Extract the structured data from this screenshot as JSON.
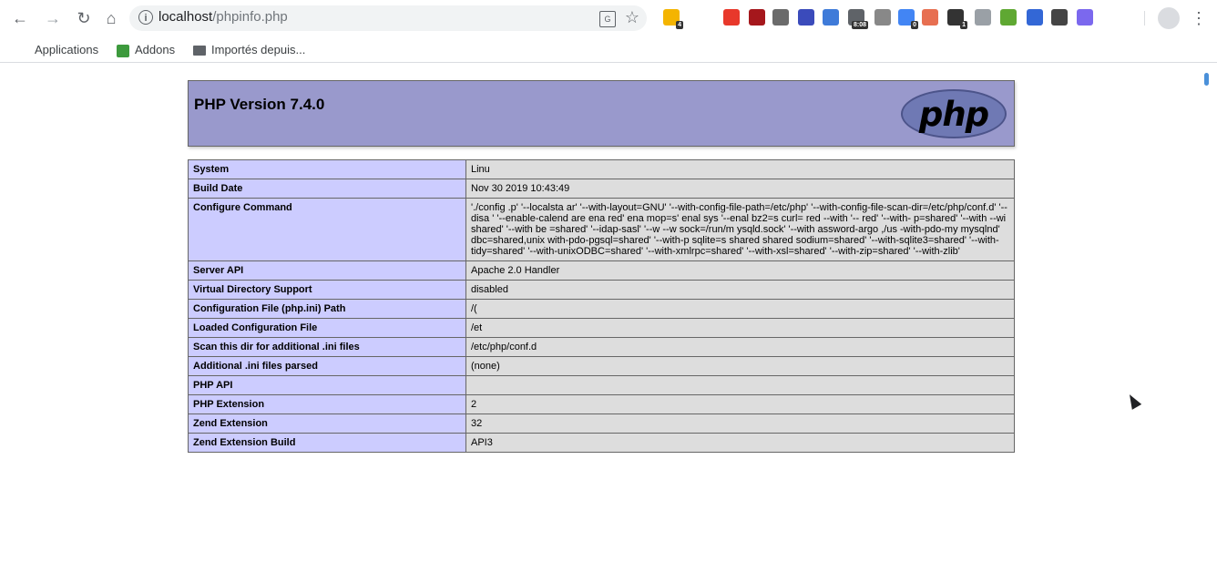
{
  "browser": {
    "url_host": "localhost",
    "url_path": "/phpinfo.php",
    "extensions": [
      {
        "name": "ext-yellow-icon",
        "color": "#f4b400",
        "badge": "4"
      },
      {
        "name": "font-icon",
        "color": "#ffffff",
        "badge": ""
      },
      {
        "name": "adblock-icon",
        "color": "#e8382b",
        "badge": ""
      },
      {
        "name": "ublock-icon",
        "color": "#a5171c",
        "badge": ""
      },
      {
        "name": "bird-icon",
        "color": "#6b6b6b",
        "badge": ""
      },
      {
        "name": "block-icon",
        "color": "#3b4bbb",
        "badge": ""
      },
      {
        "name": "s-icon",
        "color": "#3f7bd9",
        "badge": ""
      },
      {
        "name": "clock-icon",
        "color": "#5f6368",
        "badge": "8:08"
      },
      {
        "name": "dots-icon",
        "color": "#888888",
        "badge": ""
      },
      {
        "name": "person-icon",
        "color": "#4285f4",
        "badge": "0"
      },
      {
        "name": "camera-icon",
        "color": "#e76f51",
        "badge": ""
      },
      {
        "name": "flag-icon",
        "color": "#333333",
        "badge": "1"
      },
      {
        "name": "shield-icon",
        "color": "#9aa0a6",
        "badge": ""
      },
      {
        "name": "download-icon",
        "color": "#5fa832",
        "badge": ""
      },
      {
        "name": "v-icon",
        "color": "#3367d6",
        "badge": ""
      },
      {
        "name": "square-icon",
        "color": "#444444",
        "badge": ""
      },
      {
        "name": "c-icon",
        "color": "#7b68ee",
        "badge": ""
      }
    ]
  },
  "bookmarks": {
    "apps": "Applications",
    "addons": "Addons",
    "imported": "Importés depuis..."
  },
  "php": {
    "version_title": "PHP Version 7.4.0",
    "logo_text": "php",
    "rows": [
      {
        "key": "System",
        "value": "Linu"
      },
      {
        "key": "Build Date",
        "value": "Nov 30 2019 10:43:49"
      },
      {
        "key": "Configure Command",
        "value": "'./config                                                                        .p' '--localsta          ar' '--with-layout=GNU' '--with-config-file-path=/etc/php' '--with-config-file-scan-dir=/etc/php/conf.d' '--disa                                              ' '--enable-calend        are   ena                    red'                        ena                        mop=s'                               enal sys               '--enal                                    bz2=s         curl=    red                     --with                      '--          red' '--with-                         p=shared' '--with                      --wi      shared' '--with    be              =shared' '--idap-sasl' '--w            --w       sock=/run/m     ysqld.sock' '--with                                  assword-argo                  ,/us   -with-pdo-my           mysqlnd'               dbc=shared,unix        with-pdo-pgsql=shared' '--with-p sqlite=s             shared                                         shared sodium=shared' '--with-sqlite3=shared' '--with-tidy=shared' '--with-unixODBC=shared' '--with-xmlrpc=shared' '--with-xsl=shared' '--with-zip=shared' '--with-zlib'"
      },
      {
        "key": "Server API",
        "value": "Apache 2.0 Handler"
      },
      {
        "key": "Virtual Directory Support",
        "value": "disabled"
      },
      {
        "key": "Configuration File (php.ini) Path",
        "value": "/("
      },
      {
        "key": "Loaded Configuration File",
        "value": "/et"
      },
      {
        "key": "Scan this dir for additional .ini files",
        "value": "/etc/php/conf.d"
      },
      {
        "key": "Additional .ini files parsed",
        "value": "(none)"
      },
      {
        "key": "PHP API",
        "value": ""
      },
      {
        "key": "PHP Extension",
        "value": "2"
      },
      {
        "key": "Zend Extension",
        "value": "32"
      },
      {
        "key": "Zend Extension Build",
        "value": "API3"
      }
    ]
  }
}
